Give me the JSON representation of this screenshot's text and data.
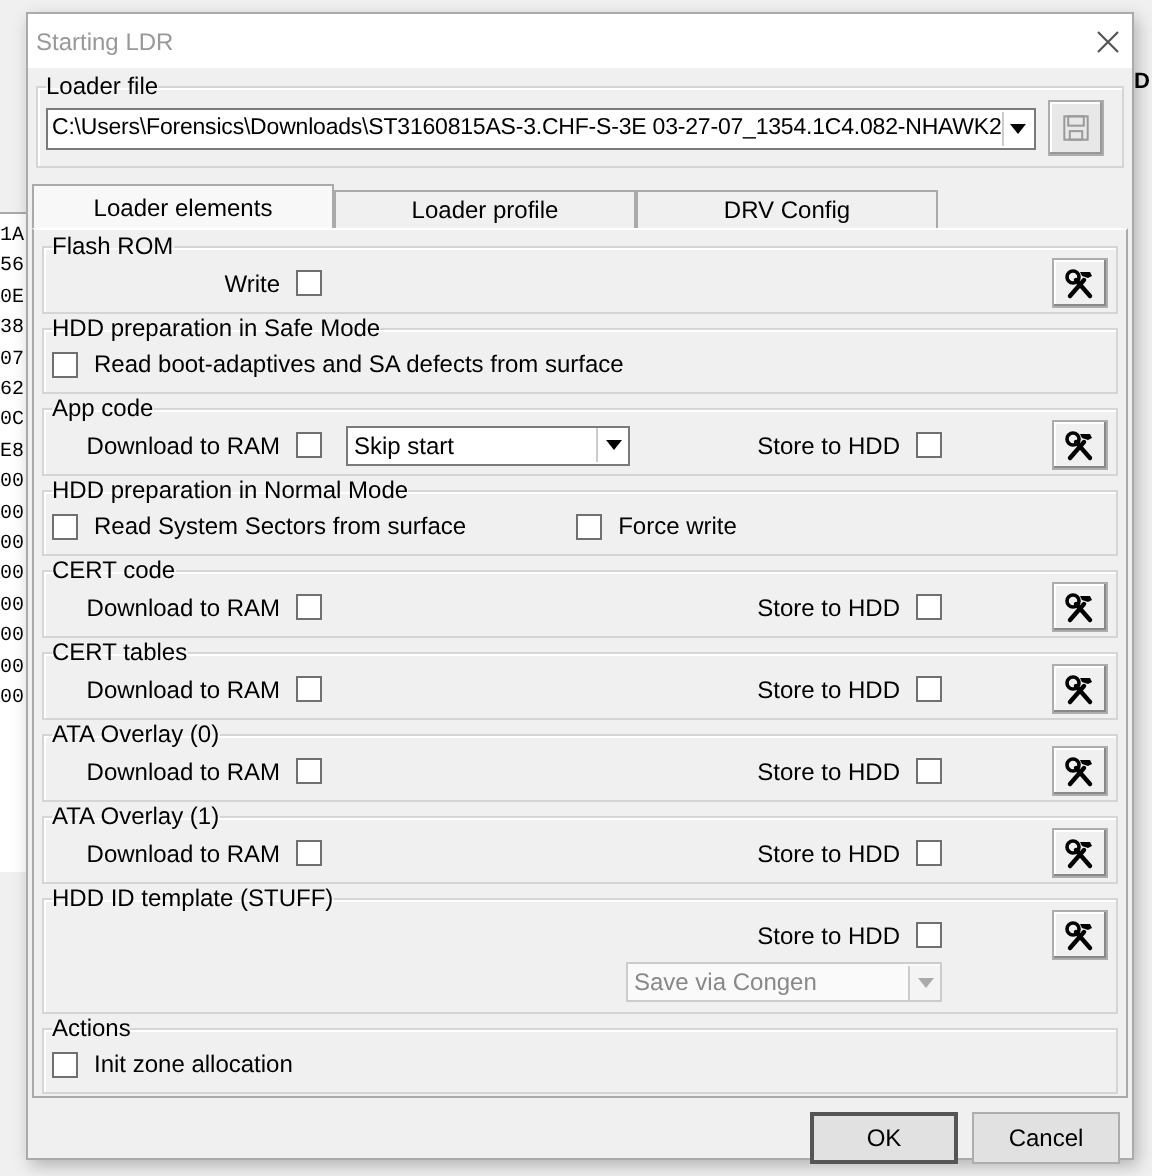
{
  "background": {
    "hex_column": [
      "1A",
      "56",
      "0E",
      "38",
      "07",
      "62",
      "0C",
      "E8",
      "00",
      "00",
      "00",
      "00",
      "00",
      "00",
      "00",
      "00"
    ],
    "edge_text": "D"
  },
  "window": {
    "title": "Starting LDR"
  },
  "loader_file": {
    "label": "Loader file",
    "path": "C:\\Users\\Forensics\\Downloads\\ST3160815AS-3.CHF-S-3E 03-27-07_1354.1C4.082-NHAWK2",
    "save_disabled": true
  },
  "tabs": [
    {
      "label": "Loader elements",
      "selected": true
    },
    {
      "label": "Loader profile",
      "selected": false
    },
    {
      "label": "DRV Config",
      "selected": false
    }
  ],
  "groups": [
    {
      "title": "Flash ROM",
      "rows": [
        {
          "left": [
            {
              "kind": "check_label_first",
              "label": "Write",
              "checked": false
            }
          ],
          "right": [
            {
              "kind": "tool_button"
            }
          ]
        }
      ]
    },
    {
      "title": "HDD preparation in Safe Mode",
      "rows": [
        {
          "left": [
            {
              "kind": "check_box_first",
              "label": "Read boot-adaptives and SA defects from surface",
              "checked": false
            }
          ]
        }
      ]
    },
    {
      "title": "App code",
      "rows": [
        {
          "left": [
            {
              "kind": "check_label_first",
              "label": "Download to RAM",
              "checked": false
            },
            {
              "kind": "dropdown",
              "value": "Skip start",
              "disabled": false
            }
          ],
          "right": [
            {
              "kind": "check_label_first",
              "label": "Store to HDD",
              "checked": false
            },
            {
              "kind": "tool_button"
            }
          ]
        }
      ]
    },
    {
      "title": "HDD preparation in Normal Mode",
      "rows": [
        {
          "left": [
            {
              "kind": "check_box_first",
              "label": "Read System Sectors from surface",
              "checked": false
            },
            {
              "kind": "check_box_first",
              "label": "Force write",
              "checked": false
            }
          ]
        }
      ]
    },
    {
      "title": "CERT code",
      "rows": [
        {
          "left": [
            {
              "kind": "check_label_first",
              "label": "Download to RAM",
              "checked": false
            }
          ],
          "right": [
            {
              "kind": "check_label_first",
              "label": "Store to HDD",
              "checked": false
            },
            {
              "kind": "tool_button"
            }
          ]
        }
      ]
    },
    {
      "title": "CERT tables",
      "rows": [
        {
          "left": [
            {
              "kind": "check_label_first",
              "label": "Download to RAM",
              "checked": false
            }
          ],
          "right": [
            {
              "kind": "check_label_first",
              "label": "Store to HDD",
              "checked": false
            },
            {
              "kind": "tool_button"
            }
          ]
        }
      ]
    },
    {
      "title": "ATA Overlay (0)",
      "rows": [
        {
          "left": [
            {
              "kind": "check_label_first",
              "label": "Download to RAM",
              "checked": false
            }
          ],
          "right": [
            {
              "kind": "check_label_first",
              "label": "Store to HDD",
              "checked": false
            },
            {
              "kind": "tool_button"
            }
          ]
        }
      ]
    },
    {
      "title": "ATA Overlay (1)",
      "rows": [
        {
          "left": [
            {
              "kind": "check_label_first",
              "label": "Download to RAM",
              "checked": false
            }
          ],
          "right": [
            {
              "kind": "check_label_first",
              "label": "Store to HDD",
              "checked": false
            },
            {
              "kind": "tool_button"
            }
          ]
        }
      ]
    },
    {
      "title": "HDD ID template (STUFF)",
      "rows": [
        {
          "right": [
            {
              "kind": "check_label_first",
              "label": "Store to HDD",
              "checked": false
            },
            {
              "kind": "tool_button"
            }
          ]
        },
        {
          "right": [
            {
              "kind": "dropdown",
              "value": "Save via Congen",
              "disabled": true
            }
          ]
        }
      ]
    },
    {
      "title": "Actions",
      "rows": [
        {
          "left": [
            {
              "kind": "check_box_first",
              "label": "Init zone allocation",
              "checked": false
            }
          ]
        }
      ]
    }
  ],
  "buttons": [
    {
      "label": "OK",
      "default": true
    },
    {
      "label": "Cancel",
      "default": false
    }
  ]
}
